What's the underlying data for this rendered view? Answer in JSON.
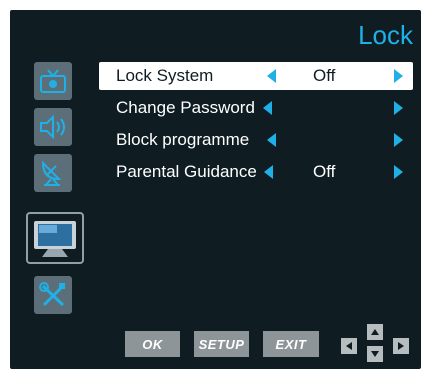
{
  "header": {
    "title": "Lock"
  },
  "sidebar": {
    "items": [
      {
        "icon": "picture-icon",
        "selected": false
      },
      {
        "icon": "sound-icon",
        "selected": false
      },
      {
        "icon": "satellite-icon",
        "selected": false
      },
      {
        "icon": "tv-screen-icon",
        "selected": true
      },
      {
        "icon": "tools-icon",
        "selected": false
      }
    ]
  },
  "menu": {
    "items": [
      {
        "label": "Lock System",
        "value": "Off",
        "active": true
      },
      {
        "label": "Change Password",
        "value": "",
        "active": false
      },
      {
        "label": "Block programme",
        "value": "",
        "active": false
      },
      {
        "label": "Parental Guidance",
        "value": "Off",
        "active": false
      }
    ]
  },
  "footer": {
    "ok_label": "OK",
    "setup_label": "SETUP",
    "exit_label": "EXIT"
  },
  "colors": {
    "background": "#0f1c22",
    "accent": "#1fb0e8",
    "icon_tile": "#5c6e78",
    "button": "#8e9599"
  }
}
